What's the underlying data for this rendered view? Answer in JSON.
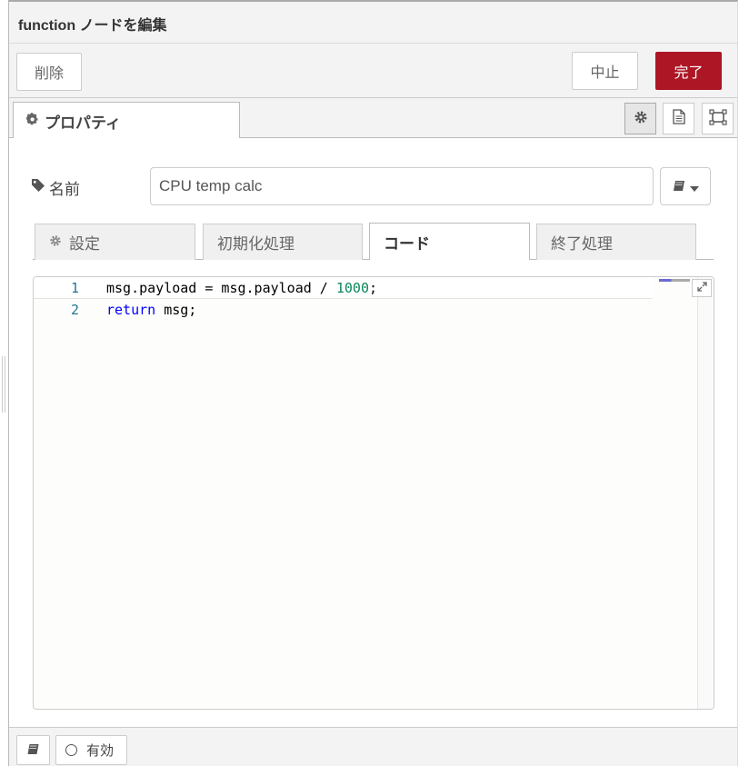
{
  "window": {
    "title": "function ノードを編集"
  },
  "toolbar": {
    "delete_label": "削除",
    "cancel_label": "中止",
    "done_label": "完了"
  },
  "tabs": {
    "properties_label": "プロパティ"
  },
  "icons": {
    "settings": "gear-icon",
    "description": "document-icon",
    "appearance": "frame-icon",
    "tag": "tag-icon",
    "library": "book-icon",
    "expand": "expand-icon",
    "enable": "circle-icon"
  },
  "form": {
    "name_label": "名前",
    "name_value": "CPU temp calc"
  },
  "subtabs": {
    "setup": "設定",
    "init": "初期化処理",
    "code": "コード",
    "finalize": "終了処理"
  },
  "editor": {
    "lines": [
      {
        "number": "1",
        "text": "msg.payload = msg.payload / 1000;"
      },
      {
        "number": "2",
        "text": "return msg;"
      }
    ]
  },
  "footer": {
    "enabled_label": "有効"
  },
  "colors": {
    "done_button": "#ad1625",
    "keyword": "#0000ff",
    "number": "#098658",
    "line_number": "#237893"
  }
}
